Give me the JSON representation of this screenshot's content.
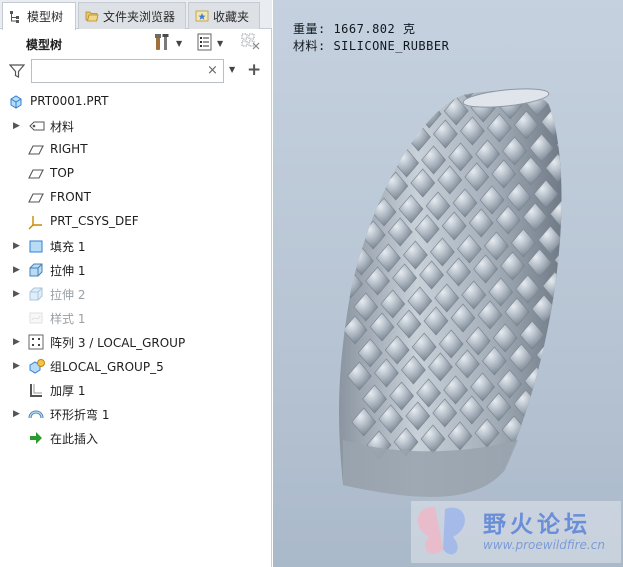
{
  "tabs": [
    {
      "label": "模型树",
      "icon": "tree-icon",
      "active": true
    },
    {
      "label": "文件夹浏览器",
      "icon": "folder-icon",
      "active": false
    },
    {
      "label": "收藏夹",
      "icon": "favorites-icon",
      "active": false
    }
  ],
  "toolbar": {
    "title": "模型树",
    "settings_icon": "tools-icon",
    "show_icon": "list-icon",
    "grid_icon": "grid-icon"
  },
  "filter": {
    "value": "",
    "placeholder": "",
    "clear_glyph": "×",
    "add_glyph": "+"
  },
  "tree": {
    "root": {
      "label": "PRT0001.PRT",
      "icon": "part-icon"
    },
    "items": [
      {
        "label": "材料",
        "icon": "material-icon",
        "expandable": true,
        "muted": false
      },
      {
        "label": "RIGHT",
        "icon": "datum-plane-icon",
        "expandable": false,
        "muted": false
      },
      {
        "label": "TOP",
        "icon": "datum-plane-icon",
        "expandable": false,
        "muted": false
      },
      {
        "label": "FRONT",
        "icon": "datum-plane-icon",
        "expandable": false,
        "muted": false
      },
      {
        "label": "PRT_CSYS_DEF",
        "icon": "csys-icon",
        "expandable": false,
        "muted": false
      },
      {
        "label": "填充 1",
        "icon": "fill-icon",
        "expandable": true,
        "muted": false
      },
      {
        "label": "拉伸 1",
        "icon": "extrude-icon",
        "expandable": true,
        "muted": false
      },
      {
        "label": "拉伸 2",
        "icon": "extrude-icon",
        "expandable": true,
        "muted": true
      },
      {
        "label": "样式 1",
        "icon": "style-icon",
        "expandable": false,
        "muted": true
      },
      {
        "label": "阵列 3 / LOCAL_GROUP",
        "icon": "pattern-icon",
        "expandable": true,
        "muted": false
      },
      {
        "label": "组LOCAL_GROUP_5",
        "icon": "group-icon",
        "expandable": true,
        "muted": false
      },
      {
        "label": "加厚 1",
        "icon": "thicken-icon",
        "expandable": false,
        "muted": false
      },
      {
        "label": "环形折弯 1",
        "icon": "toroidal-bend-icon",
        "expandable": true,
        "muted": false
      },
      {
        "label": "在此插入",
        "icon": "insert-here-icon",
        "expandable": false,
        "muted": false
      }
    ]
  },
  "viewport": {
    "mass_line": "重量: 1667.802 克",
    "material_line": "材料: SILICONE_RUBBER",
    "model_color": "#a7b0ba"
  },
  "watermark": {
    "text": "野火论坛",
    "url": "www.proewildfire.cn",
    "logo_icon": "butterfly-logo-icon"
  },
  "colors": {
    "accent": "#2f7fd8",
    "viewport_top": "#c5d1de",
    "viewport_bottom": "#aab9ca"
  }
}
